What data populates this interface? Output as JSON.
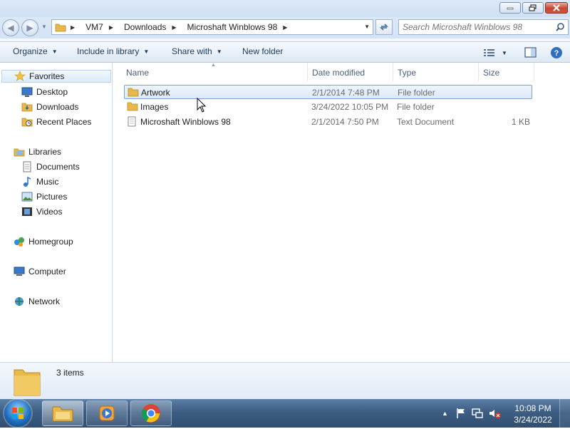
{
  "window": {
    "breadcrumb": [
      "VM7",
      "Downloads",
      "Microshaft Winblows 98"
    ],
    "search_placeholder": "Search Microshaft Winblows 98"
  },
  "toolbar": {
    "organize": "Organize",
    "include_in_library": "Include in library",
    "share_with": "Share with",
    "new_folder": "New folder"
  },
  "nav": {
    "favorites": {
      "label": "Favorites",
      "items": [
        "Desktop",
        "Downloads",
        "Recent Places"
      ]
    },
    "libraries": {
      "label": "Libraries",
      "items": [
        "Documents",
        "Music",
        "Pictures",
        "Videos"
      ]
    },
    "homegroup": "Homegroup",
    "computer": "Computer",
    "network": "Network"
  },
  "columns": {
    "name": "Name",
    "date": "Date modified",
    "type": "Type",
    "size": "Size"
  },
  "files": [
    {
      "name": "Artwork",
      "date": "2/1/2014 7:48 PM",
      "type": "File folder",
      "size": "",
      "icon": "folder-icon",
      "selected": true
    },
    {
      "name": "Images",
      "date": "3/24/2022 10:05 PM",
      "type": "File folder",
      "size": "",
      "icon": "folder-icon",
      "selected": false
    },
    {
      "name": "Microshaft Winblows 98",
      "date": "2/1/2014 7:50 PM",
      "type": "Text Document",
      "size": "1 KB",
      "icon": "text-document-icon",
      "selected": false
    }
  ],
  "details": {
    "count": "3 items"
  },
  "taskbar": {
    "time": "10:08 PM",
    "date": "3/24/2022",
    "apps": [
      "windows-explorer-icon",
      "media-player-icon",
      "chrome-icon"
    ]
  },
  "colors": {
    "accent": "#3d5d82",
    "selection": "#dce9f8",
    "folder": "#e8b84a"
  }
}
